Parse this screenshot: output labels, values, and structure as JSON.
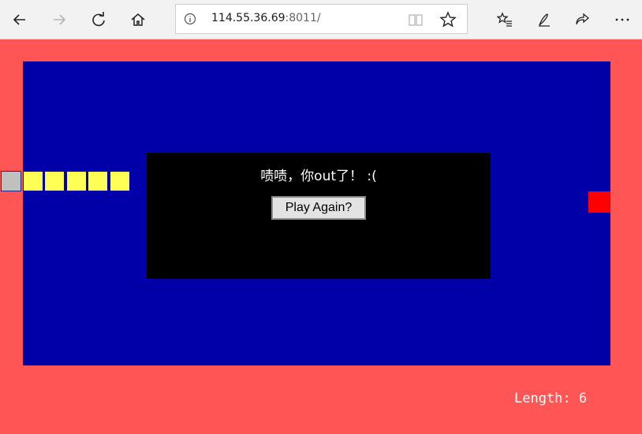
{
  "browser": {
    "url_host": "114.55.36.69",
    "url_port": ":8011/",
    "icons": [
      "back-icon",
      "forward-icon",
      "refresh-icon",
      "home-icon",
      "info-icon",
      "reading-view-icon",
      "favorite-star-icon",
      "favorites-list-icon",
      "pen-icon",
      "share-icon",
      "more-icon"
    ]
  },
  "game": {
    "colors": {
      "background": "#ff5555",
      "board": "#0000a8",
      "snake_body": "#ffff55",
      "snake_head": "#c0c0c0",
      "food": "#ff0000",
      "dialog": "#000000"
    },
    "snake_segments": 6,
    "game_over": {
      "message": "啧啧，你out了！ :(",
      "button_label": "Play Again?"
    },
    "length_label": "Length: 6"
  }
}
